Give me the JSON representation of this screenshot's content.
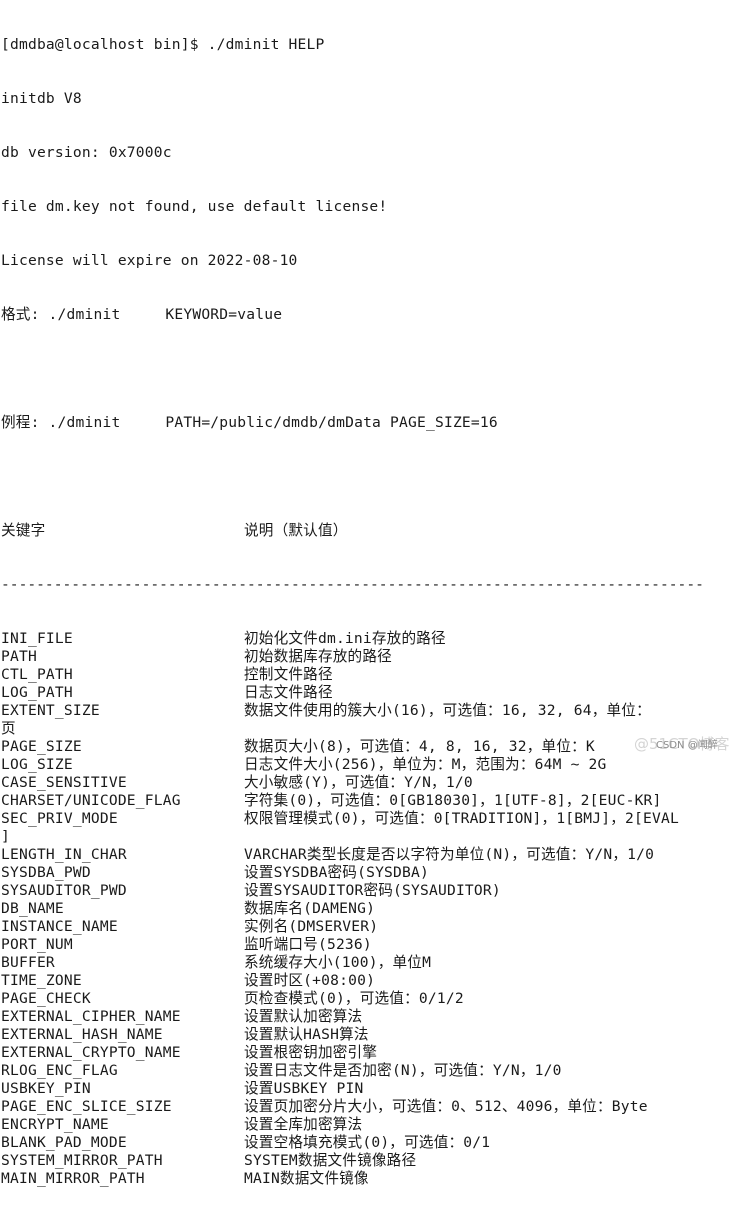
{
  "terminal": {
    "prompt": "[dmdba@localhost bin]$ ./dminit HELP",
    "header_lines": [
      "initdb V8",
      "db version: 0x7000c",
      "file dm.key not found, use default license!",
      "License will expire on 2022-08-10"
    ],
    "format_line": "格式: ./dminit     KEYWORD=value",
    "example_line": "例程: ./dminit     PATH=/public/dmdb/dmData PAGE_SIZE=16",
    "table_header": {
      "keyword": "关键字",
      "description": "说明（默认值）"
    },
    "separator": "--------------------------------------------------------------------------------",
    "rows": [
      {
        "keyword": "INI_FILE",
        "description": "初始化文件dm.ini存放的路径"
      },
      {
        "keyword": "PATH",
        "description": "初始数据库存放的路径"
      },
      {
        "keyword": "CTL_PATH",
        "description": "控制文件路径"
      },
      {
        "keyword": "LOG_PATH",
        "description": "日志文件路径"
      },
      {
        "keyword": "EXTENT_SIZE",
        "description": "数据文件使用的簇大小(16)，可选值：16, 32, 64，单位：",
        "wrap": "页"
      },
      {
        "keyword": "PAGE_SIZE",
        "description": "数据页大小(8)，可选值：4, 8, 16, 32，单位：K"
      },
      {
        "keyword": "LOG_SIZE",
        "description": "日志文件大小(256)，单位为：M，范围为：64M ~ 2G"
      },
      {
        "keyword": "CASE_SENSITIVE",
        "description": "大小敏感(Y)，可选值：Y/N，1/0"
      },
      {
        "keyword": "CHARSET/UNICODE_FLAG",
        "description": "字符集(0)，可选值：0[GB18030]，1[UTF-8]，2[EUC-KR]"
      },
      {
        "keyword": "SEC_PRIV_MODE",
        "description": "权限管理模式(0)，可选值：0[TRADITION]，1[BMJ]，2[EVAL",
        "wrap": "]"
      },
      {
        "keyword": "LENGTH_IN_CHAR",
        "description": "VARCHAR类型长度是否以字符为单位(N)，可选值：Y/N，1/0"
      },
      {
        "keyword": "SYSDBA_PWD",
        "description": "设置SYSDBA密码(SYSDBA)"
      },
      {
        "keyword": "SYSAUDITOR_PWD",
        "description": "设置SYSAUDITOR密码(SYSAUDITOR)"
      },
      {
        "keyword": "DB_NAME",
        "description": "数据库名(DAMENG)"
      },
      {
        "keyword": "INSTANCE_NAME",
        "description": "实例名(DMSERVER)"
      },
      {
        "keyword": "PORT_NUM",
        "description": "监听端口号(5236)"
      },
      {
        "keyword": "BUFFER",
        "description": "系统缓存大小(100)，单位M"
      },
      {
        "keyword": "TIME_ZONE",
        "description": "设置时区(+08:00)"
      },
      {
        "keyword": "PAGE_CHECK",
        "description": "页检查模式(0)，可选值：0/1/2"
      },
      {
        "keyword": "EXTERNAL_CIPHER_NAME",
        "description": "设置默认加密算法"
      },
      {
        "keyword": "EXTERNAL_HASH_NAME",
        "description": "设置默认HASH算法"
      },
      {
        "keyword": "EXTERNAL_CRYPTO_NAME",
        "description": "设置根密钥加密引擎"
      },
      {
        "keyword": "RLOG_ENC_FLAG",
        "description": "设置日志文件是否加密(N)，可选值：Y/N，1/0"
      },
      {
        "keyword": "USBKEY_PIN",
        "description": "设置USBKEY PIN"
      },
      {
        "keyword": "PAGE_ENC_SLICE_SIZE",
        "description": "设置页加密分片大小，可选值：0、512、4096，单位：Byte"
      },
      {
        "keyword": "ENCRYPT_NAME",
        "description": "设置全库加密算法"
      },
      {
        "keyword": "BLANK_PAD_MODE",
        "description": "设置空格填充模式(0)，可选值：0/1"
      },
      {
        "keyword": "SYSTEM_MIRROR_PATH",
        "description": "SYSTEM数据文件镜像路径"
      },
      {
        "keyword": "MAIN_MIRROR_PATH",
        "description": "MAIN数据文件镜像"
      }
    ]
  },
  "watermark": {
    "primary": "@51CTO博客",
    "secondary": "CSDN @闻醉"
  }
}
